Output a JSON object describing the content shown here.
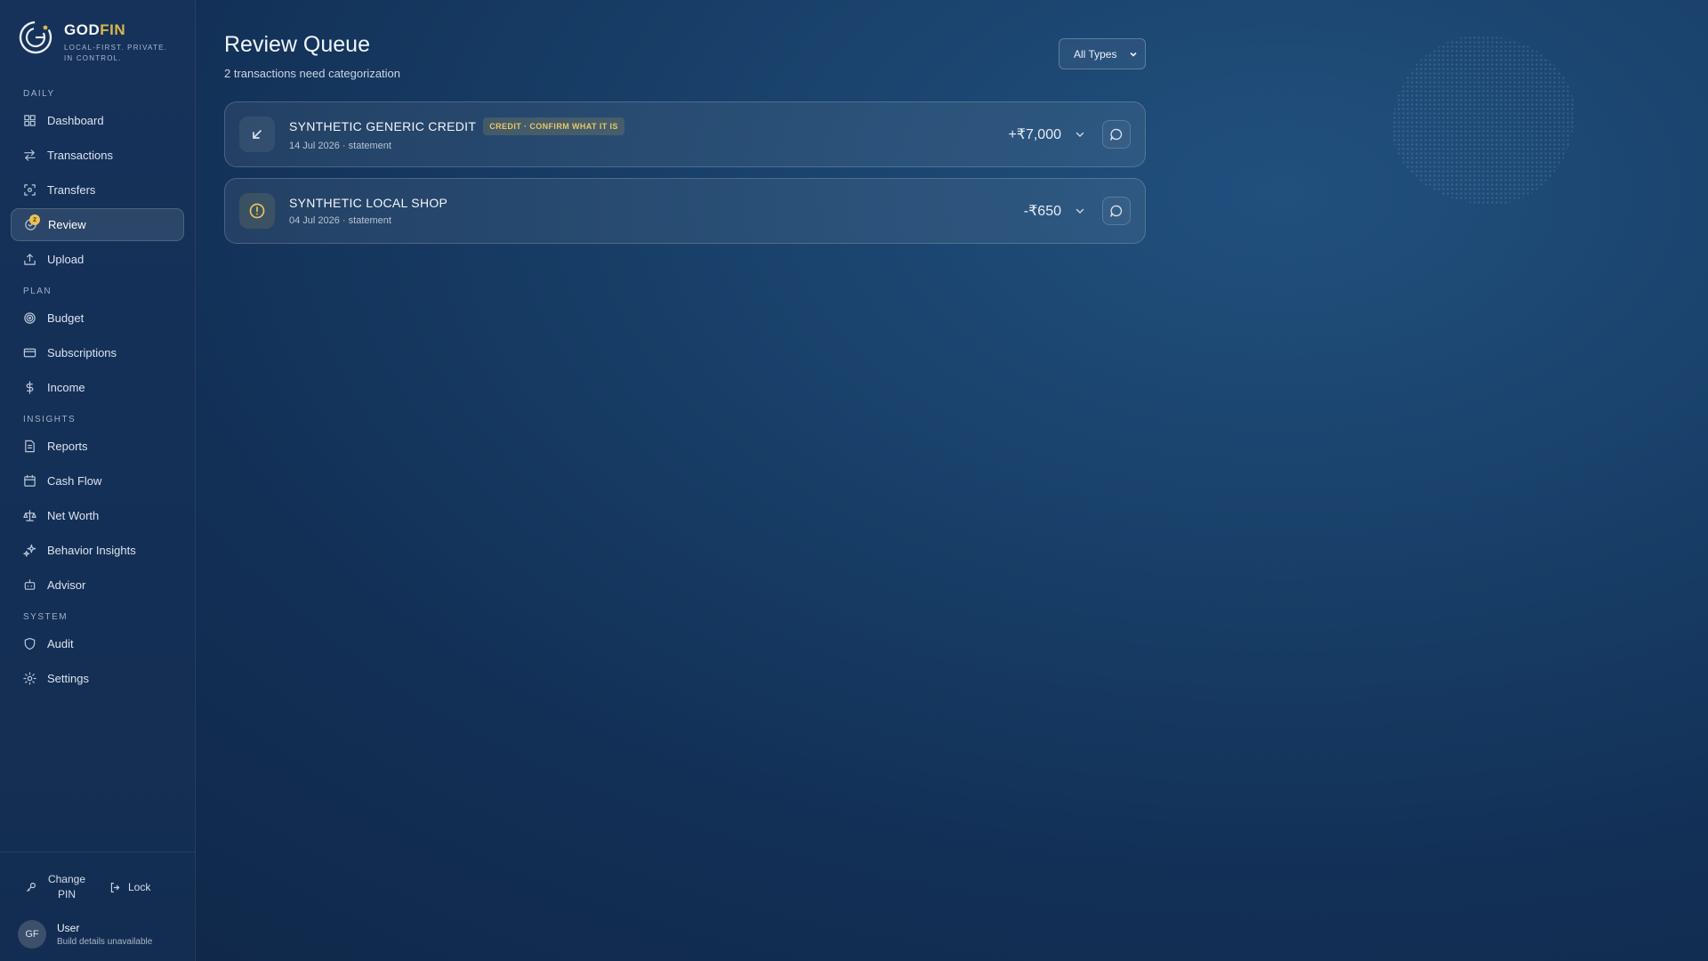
{
  "brand": {
    "name_a": "GOD",
    "name_b": "FIN",
    "tagline": "LOCAL-FIRST. PRIVATE. IN CONTROL."
  },
  "sidebar": {
    "sections": [
      {
        "label": "DAILY",
        "items": [
          {
            "label": "Dashboard",
            "icon": "grid-icon"
          },
          {
            "label": "Transactions",
            "icon": "swap-arrows-icon"
          },
          {
            "label": "Transfers",
            "icon": "scan-transfer-icon"
          },
          {
            "label": "Review",
            "icon": "review-circle-icon",
            "active": true,
            "badge": "2"
          },
          {
            "label": "Upload",
            "icon": "upload-icon"
          }
        ]
      },
      {
        "label": "PLAN",
        "items": [
          {
            "label": "Budget",
            "icon": "target-icon"
          },
          {
            "label": "Subscriptions",
            "icon": "card-icon"
          },
          {
            "label": "Income",
            "icon": "dollar-icon"
          }
        ]
      },
      {
        "label": "INSIGHTS",
        "items": [
          {
            "label": "Reports",
            "icon": "document-icon"
          },
          {
            "label": "Cash Flow",
            "icon": "calendar-icon"
          },
          {
            "label": "Net Worth",
            "icon": "scale-icon"
          },
          {
            "label": "Behavior Insights",
            "icon": "sparkles-icon"
          },
          {
            "label": "Advisor",
            "icon": "bot-icon"
          }
        ]
      },
      {
        "label": "SYSTEM",
        "items": [
          {
            "label": "Audit",
            "icon": "shield-icon"
          },
          {
            "label": "Settings",
            "icon": "gear-icon"
          }
        ]
      }
    ]
  },
  "footer": {
    "change_pin": "Change PIN",
    "lock": "Lock",
    "avatar_initials": "GF",
    "user_name": "User",
    "user_sub": "Build details unavailable"
  },
  "main": {
    "title": "Review Queue",
    "subtitle": "2 transactions need categorization",
    "filter": {
      "selected": "All Types"
    },
    "transactions": [
      {
        "title": "SYNTHETIC GENERIC CREDIT",
        "tag": "CREDIT · CONFIRM WHAT IT IS",
        "meta": "14 Jul 2026 · statement",
        "amount": "+₹7,000",
        "icon": "arrow-down-left-icon"
      },
      {
        "title": "SYNTHETIC LOCAL SHOP",
        "tag": "",
        "meta": "04 Jul 2026 · statement",
        "amount": "-₹650",
        "icon": "alert-circle-icon"
      }
    ]
  },
  "colors": {
    "accent": "#e8c25a",
    "background": "#183f68",
    "sidebar": "#16325a"
  }
}
